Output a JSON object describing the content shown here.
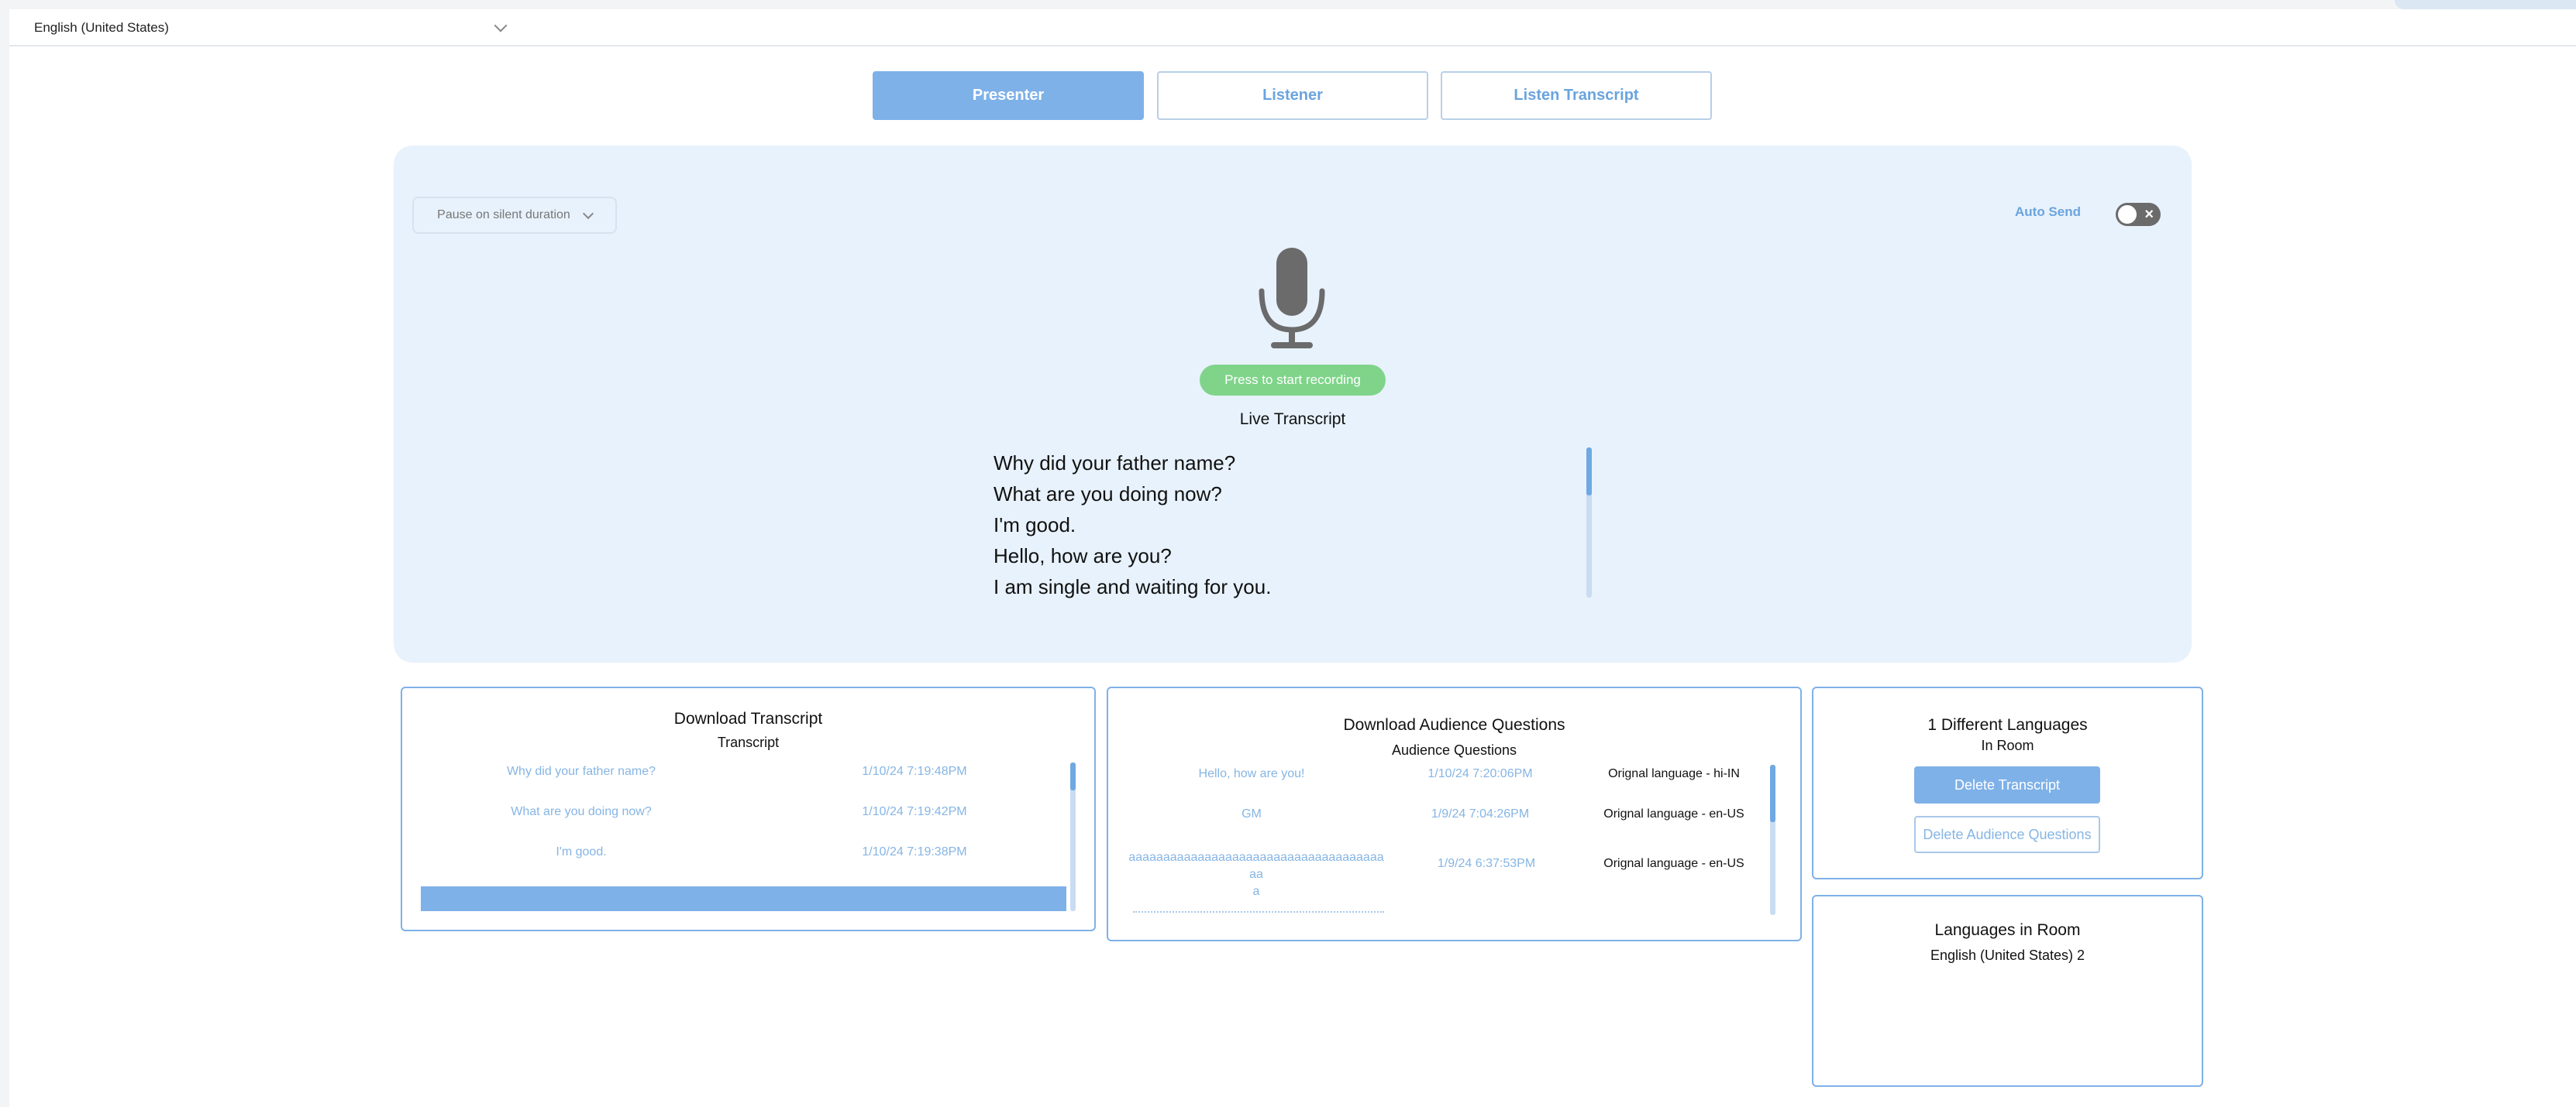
{
  "language_selector": {
    "value": "English (United States)"
  },
  "tabs": [
    {
      "label": "Presenter",
      "active": true
    },
    {
      "label": "Listener",
      "active": false
    },
    {
      "label": "Listen Transcript",
      "active": false
    }
  ],
  "presenter": {
    "pause_select": "Pause on silent duration",
    "auto_send_label": "Auto Send",
    "auto_send_enabled": false,
    "record_button": "Press to start recording",
    "live_transcript_title": "Live Transcript",
    "live_lines": [
      "Why did your father name?",
      "What are you doing now?",
      "I'm good.",
      "Hello, how are you?",
      "I am single and waiting for you."
    ]
  },
  "transcript_card": {
    "title": "Download Transcript",
    "subtitle": "Transcript",
    "rows": [
      {
        "text": "Why did your father name?",
        "date": "1/10/24 7:19:48PM"
      },
      {
        "text": "What are you doing now?",
        "date": "1/10/24 7:19:42PM"
      },
      {
        "text": "I'm good.",
        "date": "1/10/24 7:19:38PM"
      }
    ]
  },
  "questions_card": {
    "title": "Download Audience Questions",
    "subtitle": "Audience Questions",
    "rows": [
      {
        "text": "Hello, how are you!",
        "date": "1/10/24 7:20:06PM",
        "lang": "Orignal language - hi-IN"
      },
      {
        "text": "GM",
        "date": "1/9/24 7:04:26PM",
        "lang": "Orignal language - en-US"
      },
      {
        "text": "aaaaaaaaaaaaaaaaaaaaaaaaaaaaaaaaaaaaaaa\na",
        "date": "1/9/24 6:37:53PM",
        "lang": "Orignal language - en-US"
      }
    ]
  },
  "languages_card": {
    "title": "1 Different Languages",
    "subtitle": "In Room",
    "delete_transcript": "Delete Transcript",
    "delete_questions": "Delete Audience Questions"
  },
  "room_card": {
    "title": "Languages in Room",
    "entry": "English (United States) 2"
  },
  "colors": {
    "accent": "#7eb1e8",
    "panel_bg": "#e8f2fc",
    "record_green": "#7fd48a",
    "link_blue": "#86b5e4"
  }
}
